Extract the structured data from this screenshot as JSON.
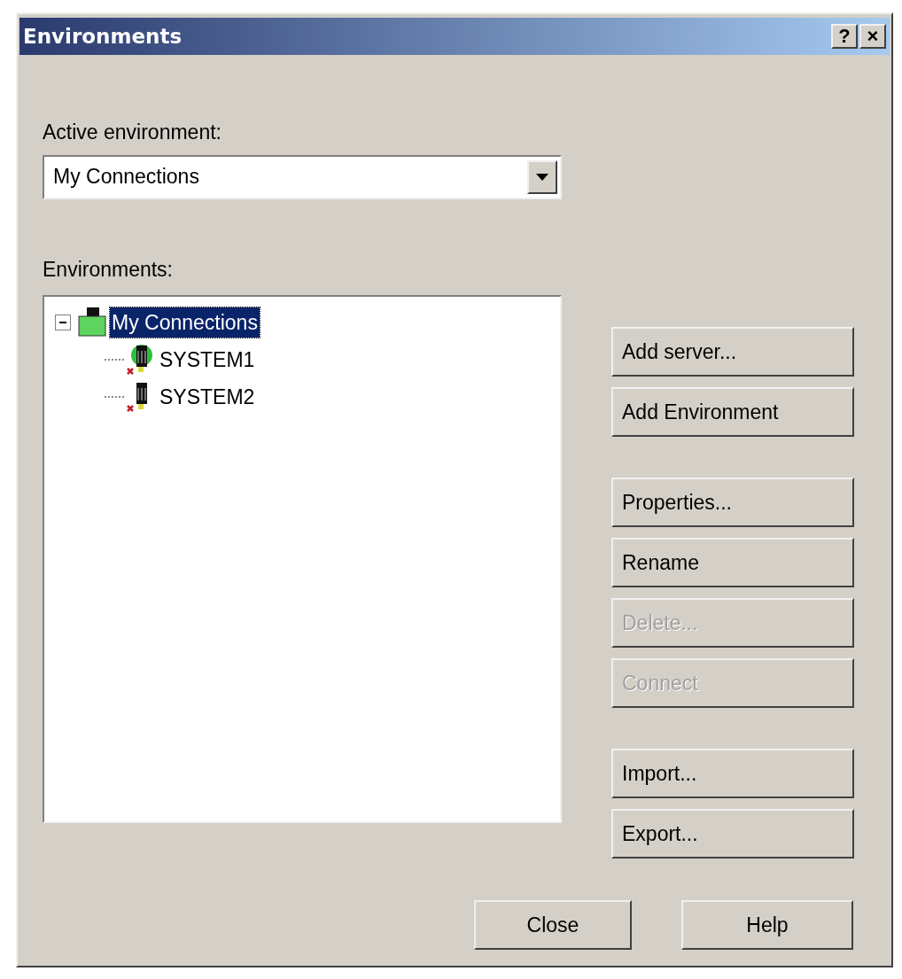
{
  "window": {
    "title": "Environments",
    "title_buttons": [
      "?",
      "×"
    ]
  },
  "active_environment": {
    "label": "Active environment:",
    "value": "My Connections"
  },
  "environments": {
    "label": "Environments:",
    "tree": [
      {
        "label": "My Connections",
        "kind": "environment",
        "selected": true,
        "expanded": true,
        "children": [
          {
            "label": "SYSTEM1",
            "kind": "server-globe",
            "selected": false
          },
          {
            "label": "SYSTEM2",
            "kind": "server",
            "selected": false
          }
        ]
      }
    ]
  },
  "side_buttons": [
    [
      {
        "label": "Add server...",
        "disabled": false
      },
      {
        "label": "Add Environment",
        "disabled": false
      }
    ],
    [
      {
        "label": "Properties...",
        "disabled": false
      },
      {
        "label": "Rename",
        "disabled": false
      },
      {
        "label": "Delete...",
        "disabled": true
      },
      {
        "label": "Connect",
        "disabled": true
      }
    ],
    [
      {
        "label": "Import...",
        "disabled": false
      },
      {
        "label": "Export...",
        "disabled": false
      }
    ]
  ],
  "footer_buttons": [
    {
      "label": "Close",
      "disabled": false
    },
    {
      "label": "Help",
      "disabled": false
    }
  ]
}
